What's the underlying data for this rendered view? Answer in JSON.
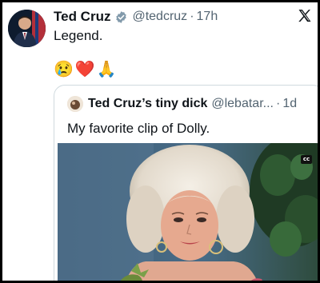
{
  "tweet": {
    "author_name": "Ted Cruz",
    "handle": "@tedcruz",
    "separator": "·",
    "time": "17h",
    "text": "Legend.",
    "emojis": "😢❤️🙏"
  },
  "quote": {
    "author_name": "Ted Cruz’s tiny dick",
    "handle": "@lebatar...",
    "separator": "·",
    "time": "1d",
    "text": "My favorite clip of Dolly.",
    "media_badge": "cc"
  },
  "icons": {
    "verified": "verified-badge-icon",
    "platform": "x-logo-icon"
  },
  "colors": {
    "verified": "#829aab",
    "secondary_text": "#536471"
  }
}
